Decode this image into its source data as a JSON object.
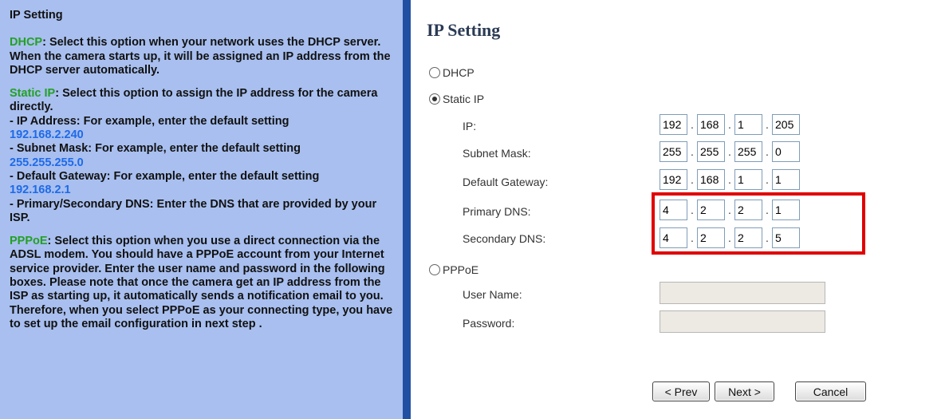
{
  "help": {
    "title": "IP Setting",
    "dhcp_term": "DHCP",
    "dhcp_text": ": Select this option when your network uses the DHCP server. When the camera starts up, it will be assigned an IP address from the DHCP server automatically.",
    "static_term": "Static IP",
    "static_text": ": Select this option to assign the IP address for the camera directly.",
    "ip_line": "- IP Address: For example, enter the default setting",
    "ip_example": "192.168.2.240",
    "mask_line": "- Subnet Mask: For example, enter the default setting",
    "mask_example": "255.255.255.0",
    "gw_line": "- Default Gateway: For example, enter the default setting",
    "gw_example": "192.168.2.1",
    "dns_line": "- Primary/Secondary DNS: Enter the DNS that are provided by your ISP.",
    "pppoe_term": "PPPoE",
    "pppoe_text": ": Select this option when you use a direct connection via the ADSL modem. You should have a PPPoE account from your Internet service provider. Enter the user name and password in the following boxes. Please note that once the camera get an IP address from the ISP as starting up, it automatically sends a notification email to you. Therefore, when you select PPPoE as your connecting type, you have to set up the email configuration in next step ."
  },
  "form": {
    "title": "IP Setting",
    "dhcp_label": "DHCP",
    "static_label": "Static IP",
    "pppoe_label": "PPPoE",
    "selected": "Static IP",
    "ip_label": "IP:",
    "ip": [
      "192",
      "168",
      "1",
      "205"
    ],
    "mask_label": "Subnet Mask:",
    "mask": [
      "255",
      "255",
      "255",
      "0"
    ],
    "gateway_label": "Default Gateway:",
    "gateway": [
      "192",
      "168",
      "1",
      "1"
    ],
    "dns1_label": "Primary DNS:",
    "dns1": [
      "4",
      "2",
      "2",
      "1"
    ],
    "dns2_label": "Secondary DNS:",
    "dns2": [
      "4",
      "2",
      "2",
      "5"
    ],
    "user_label": "User Name:",
    "user_value": "",
    "password_label": "Password:",
    "password_value": ""
  },
  "buttons": {
    "prev": "< Prev",
    "next": "Next >",
    "cancel": "Cancel"
  },
  "colors": {
    "help_bg": "#a8bfef",
    "divider": "#2150a2",
    "term_green": "#24a024",
    "example_blue": "#1e6ae8",
    "highlight": "#e00000"
  }
}
